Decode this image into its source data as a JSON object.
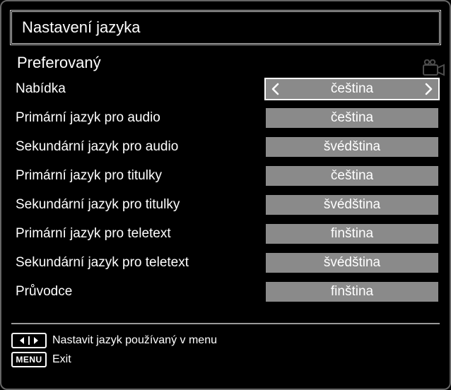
{
  "title": "Nastavení jazyka",
  "section": "Preferovaný",
  "rows": [
    {
      "label": "Nabídka",
      "value": "čeština",
      "active": true
    },
    {
      "label": "Primární jazyk pro audio",
      "value": "čeština",
      "active": false
    },
    {
      "label": "Sekundární jazyk pro audio",
      "value": "švédština",
      "active": false
    },
    {
      "label": "Primární jazyk pro titulky",
      "value": "čeština",
      "active": false
    },
    {
      "label": "Sekundární jazyk pro titulky",
      "value": "švédština",
      "active": false
    },
    {
      "label": "Primární jazyk pro teletext",
      "value": "finština",
      "active": false
    },
    {
      "label": "Sekundární jazyk pro teletext",
      "value": "švédština",
      "active": false
    },
    {
      "label": "Průvodce",
      "value": "finština",
      "active": false
    }
  ],
  "hints": {
    "lr_label": "Nastavit jazyk používaný v menu",
    "menu_badge": "MENU",
    "menu_label": "Exit"
  }
}
